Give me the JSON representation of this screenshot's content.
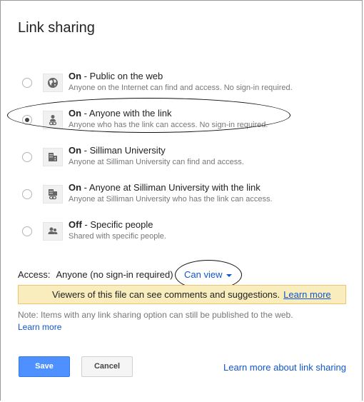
{
  "dialog": {
    "title": "Link sharing"
  },
  "options": [
    {
      "state": "On",
      "label": " - Public on the web",
      "desc": "Anyone on the Internet can find and access. No sign-in required.",
      "icon": "globe-icon",
      "selected": false
    },
    {
      "state": "On",
      "label": " - Anyone with the link",
      "desc": "Anyone who has the link can access. No sign-in required.",
      "icon": "person-link-icon",
      "selected": true
    },
    {
      "state": "On",
      "label": " - Silliman University",
      "desc": "Anyone at Silliman University can find and access.",
      "icon": "building-icon",
      "selected": false
    },
    {
      "state": "On",
      "label": " - Anyone at Silliman University with the link",
      "desc": "Anyone at Silliman University who has the link can access.",
      "icon": "building-link-icon",
      "selected": false
    },
    {
      "state": "Off",
      "label": " - Specific people",
      "desc": "Shared with specific people.",
      "icon": "people-icon",
      "selected": false
    }
  ],
  "access": {
    "label": "Access:",
    "value": "Anyone (no sign-in required)",
    "permission": "Can view"
  },
  "notice": {
    "text": "Viewers of this file can see comments and suggestions.",
    "link": "Learn more"
  },
  "note": {
    "text": "Note: Items with any link sharing option can still be published to the web.",
    "link": "Learn more"
  },
  "buttons": {
    "save": "Save",
    "cancel": "Cancel"
  },
  "footer_link": "Learn more about link sharing"
}
